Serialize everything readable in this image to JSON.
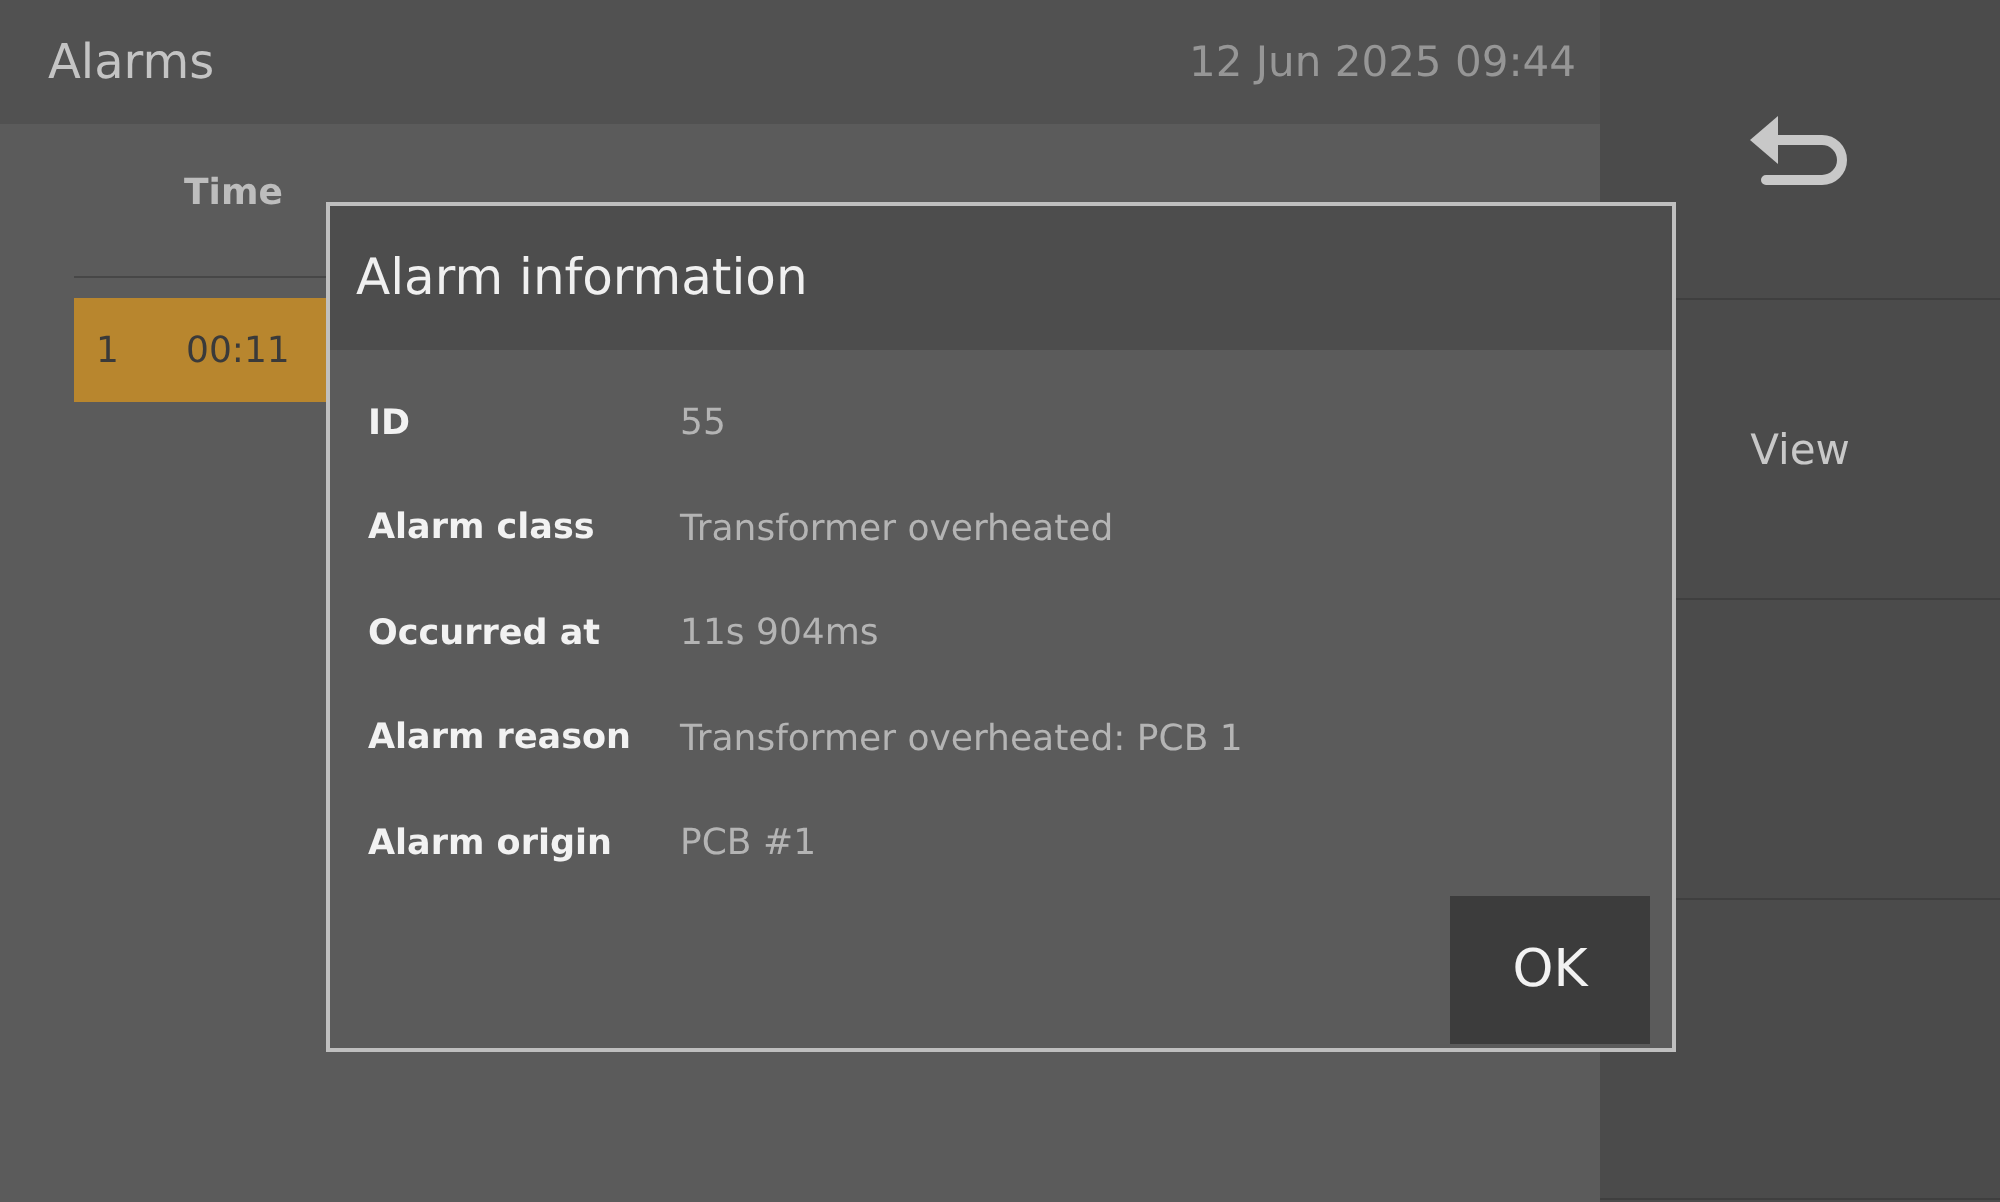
{
  "header": {
    "title": "Alarms",
    "datetime": "12 Jun 2025 09:44"
  },
  "table": {
    "columns": [
      "Time"
    ],
    "rows": [
      {
        "index": "1",
        "time": "00:11",
        "selected": true
      }
    ]
  },
  "sidebar": {
    "buttons": [
      {
        "kind": "back"
      },
      {
        "kind": "text",
        "label": "View"
      },
      {
        "kind": "empty"
      },
      {
        "kind": "empty"
      }
    ]
  },
  "dialog": {
    "title": "Alarm information",
    "fields": [
      {
        "label": "ID",
        "value": "55"
      },
      {
        "label": "Alarm class",
        "value": "Transformer overheated"
      },
      {
        "label": "Occurred at",
        "value": "11s 904ms"
      },
      {
        "label": "Alarm reason",
        "value": "Transformer overheated: PCB 1"
      },
      {
        "label": "Alarm origin",
        "value": "PCB #1"
      }
    ],
    "ok": "OK"
  }
}
